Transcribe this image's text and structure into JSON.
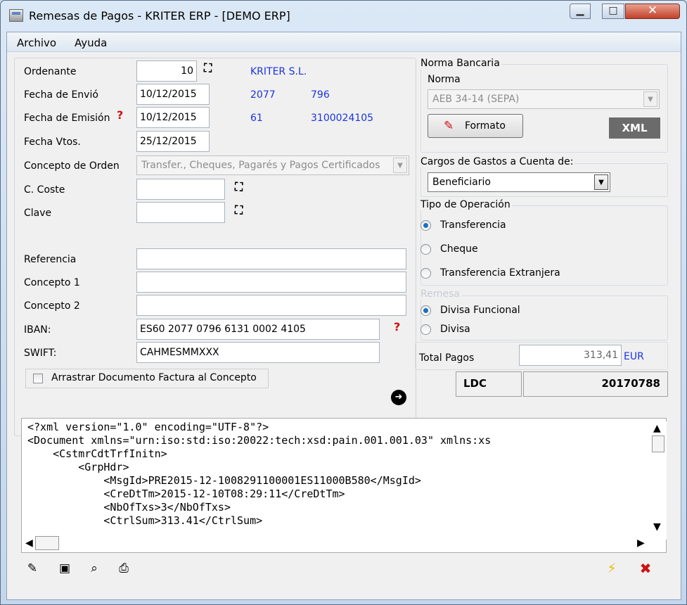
{
  "window": {
    "title": "Remesas de Pagos - KRITER ERP - [DEMO ERP]"
  },
  "menu": {
    "archivo": "Archivo",
    "ayuda": "Ayuda"
  },
  "form": {
    "ordenante_label": "Ordenante",
    "ordenante_value": "10",
    "ordenante_name": "KRITER S.L.",
    "fecha_envio_label": "Fecha de Envió",
    "fecha_envio_value": "10/12/2015",
    "fecha_envio_code1": "2077",
    "fecha_envio_code2": "796",
    "fecha_emision_label": "Fecha de Emisión",
    "fecha_emision_value": "10/12/2015",
    "fecha_emision_code1": "61",
    "fecha_emision_code2": "3100024105",
    "fecha_vtos_label": "Fecha Vtos.",
    "fecha_vtos_value": "25/12/2015",
    "concepto_orden_label": "Concepto de Orden",
    "concepto_orden_value": "Transfer., Cheques, Pagarés y Pagos Certificados",
    "c_coste_label": "C. Coste",
    "c_coste_value": "",
    "clave_label": "Clave",
    "clave_value": "",
    "referencia_label": "Referencia",
    "referencia_value": "",
    "concepto1_label": "Concepto 1",
    "concepto1_value": "",
    "concepto2_label": "Concepto 2",
    "concepto2_value": "",
    "iban_label": "IBAN:",
    "iban_value": "ES60 2077 0796 6131 0002 4105",
    "swift_label": "SWIFT:",
    "swift_value": "CAHMESMMXXX",
    "arrastrar_label": "Arrastrar Documento Factura al Concepto"
  },
  "norma": {
    "group_title": "Norma Bancaria",
    "norma_label": "Norma",
    "norma_value": "AEB 34-14 (SEPA)",
    "formato_button": "Formato",
    "xml_badge": "XML"
  },
  "cargos": {
    "group_title": "Cargos de Gastos a Cuenta de:",
    "value": "Beneficiario"
  },
  "tipo_operacion": {
    "group_title": "Tipo de Operación",
    "options": [
      "Transferencia",
      "Cheque",
      "Transferencia Extranjera"
    ],
    "selected": "Transferencia"
  },
  "remesa": {
    "group_title": "Remesa",
    "options": [
      "Divisa Funcional",
      "Divisa"
    ],
    "selected": "Divisa Funcional"
  },
  "totals": {
    "total_label": "Total Pagos",
    "total_value": "313,41",
    "currency": "EUR",
    "ldc_label": "LDC",
    "ldc_value": "20170788"
  },
  "xml_preview": {
    "lines": [
      "<?xml version=\"1.0\" encoding=\"UTF-8\"?>",
      "<Document xmlns=\"urn:iso:std:iso:20022:tech:xsd:pain.001.001.03\" xmlns:xs",
      "    <CstmrCdtTrfInitn>",
      "        <GrpHdr>",
      "            <MsgId>PRE2015-12-1008291100001ES11000B580</MsgId>",
      "            <CreDtTm>2015-12-10T08:29:11</CreDtTm>",
      "            <NbOfTxs>3</NbOfTxs>",
      "            <CtrlSum>313.41</CtrlSum>"
    ]
  },
  "icons": {
    "binoculars": "binoculars-icon",
    "help": "help-icon",
    "arrow": "arrow-right-icon",
    "edit": "edit-icon",
    "save": "save-icon",
    "preview": "print-preview-icon",
    "print": "print-icon",
    "execute": "lightning-icon",
    "close": "close-icon"
  },
  "colors": {
    "accent_blue": "#1b33e0",
    "help_red": "#cc1111",
    "close_red": "#cc1111",
    "lightning": "#e0c000"
  }
}
